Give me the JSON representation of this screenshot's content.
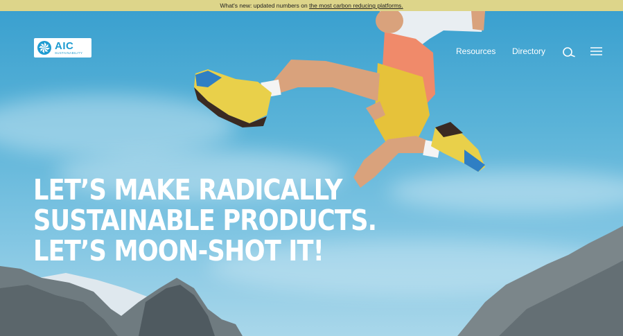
{
  "announcement": {
    "prefix": "What's new: updated numbers on ",
    "link": "the most carbon reducing platforms."
  },
  "logo": {
    "big": "AIC",
    "small": "SUSTAINABILITY",
    "icon": "pinwheel-logo-icon"
  },
  "nav": {
    "resources": "Resources",
    "directory": "Directory",
    "search_icon": "search-icon",
    "menu_icon": "hamburger-menu-icon"
  },
  "hero": {
    "lines": [
      "LET’S MAKE RADICALLY",
      "SUSTAINABLE PRODUCTS.",
      "LET’S MOON-SHOT IT!"
    ],
    "sky_color": "#3aa0cf",
    "accent": "#1d9bd1"
  }
}
